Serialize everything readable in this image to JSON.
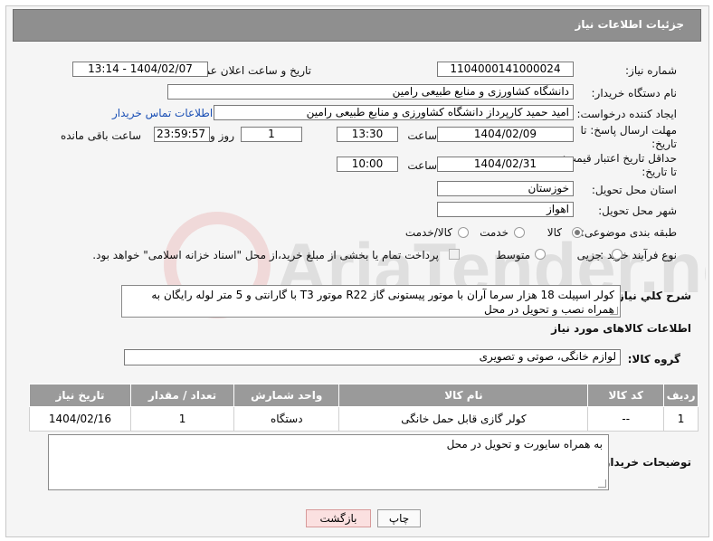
{
  "header": {
    "title": "جزئیات اطلاعات نیاز"
  },
  "form": {
    "need_number_label": "شماره نیاز:",
    "need_number": "1104000141000024",
    "announce_label": "تاریخ و ساعت اعلان عمومی:",
    "announce_value": "1404/02/07 - 13:14",
    "buyer_org_label": "نام دستگاه خریدار:",
    "buyer_org": "دانشگاه کشاورزی و منابع طبیعی رامین",
    "creator_label": "ایجاد کننده درخواست:",
    "creator": "امید حمید کارپرداز دانشگاه کشاورزی و منابع طبیعی رامین",
    "contact_link": "اطلاعات تماس خریدار",
    "reply_deadline_label_1": "مهلت ارسال پاسخ: تا",
    "reply_deadline_label_2": "تاریخ:",
    "reply_date": "1404/02/09",
    "time_label": "ساعت",
    "reply_time": "13:30",
    "days_value": "1",
    "days_label": "روز و",
    "remaining_time": "23:59:57",
    "remaining_label": "ساعت باقی مانده",
    "price_validity_label_1": "حداقل تاریخ اعتبار قیمت:",
    "price_validity_label_2": "تا تاریخ:",
    "price_date": "1404/02/31",
    "price_time": "10:00",
    "province_label": "استان محل تحویل:",
    "province": "خوزستان",
    "city_label": "شهر محل تحویل:",
    "city": "اهواز",
    "category_label": "طبقه بندی موضوعی:",
    "category_options": [
      "کالا",
      "خدمت",
      "کالا/خدمت"
    ],
    "purchase_type_label": "نوع فرآیند خرید :",
    "purchase_options": [
      "جزیی",
      "متوسط"
    ],
    "payment_note": "پرداخت تمام یا بخشی از مبلغ خرید،از محل \"اسناد خزانه اسلامی\" خواهد بود.",
    "summary_label": "شرح كلي نياز:",
    "summary": "کولر اسپیلت 18 هزار سرما آران با موتور پیستونی گاز R22 موتور T3 با گارانتی و 5 متر لوله رایگان به همراه نصب و تحویل در محل",
    "goods_info_title": "اطلاعات کالاهای مورد نیاز",
    "goods_group_label": "گروه کالا:",
    "goods_group": "لوازم خانگی، صوتی و تصویری"
  },
  "table": {
    "headers": [
      "ردیف",
      "کد کالا",
      "نام کالا",
      "واحد شمارش",
      "تعداد / مقدار",
      "تاریخ نیاز"
    ],
    "rows": [
      [
        "1",
        "--",
        "کولر گازی قابل حمل خانگی",
        "دستگاه",
        "1",
        "1404/02/16"
      ]
    ]
  },
  "buyer_notes_label": "توضیحات خریدار:",
  "buyer_notes": "به همراه سایورت و تحویل در محل",
  "buttons": {
    "print": "چاپ",
    "back": "بازگشت"
  },
  "watermark_text": "AriaTender.neT",
  "colors": {
    "header_bg": "#8f8f8f",
    "link": "#1a4fb5",
    "back_button": "#fbe0e0"
  }
}
